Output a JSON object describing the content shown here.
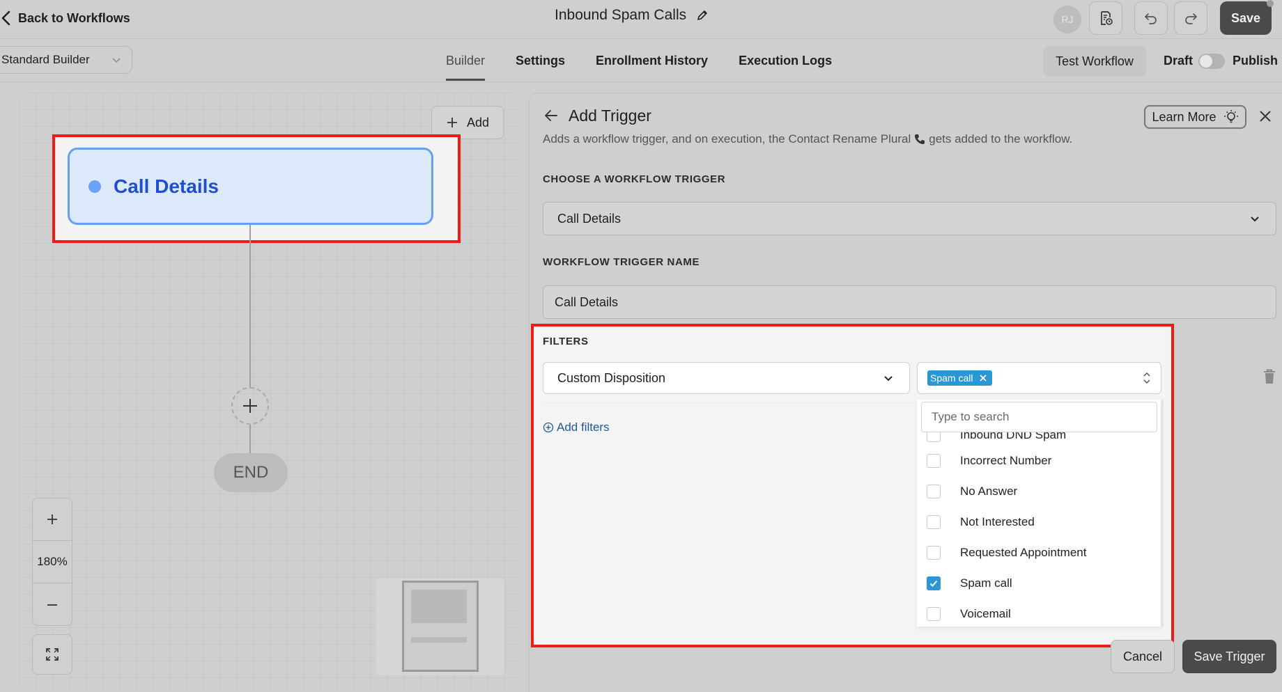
{
  "topbar": {
    "back_label": "Back to Workflows",
    "workflow_title": "Inbound Spam Calls",
    "avatar_initials": "RJ",
    "save_label": "Save"
  },
  "subbar": {
    "builder_mode": "Standard Builder",
    "tabs": [
      {
        "label": "Builder",
        "active": true
      },
      {
        "label": "Settings",
        "active": false
      },
      {
        "label": "Enrollment History",
        "active": false
      },
      {
        "label": "Execution Logs",
        "active": false
      }
    ],
    "test_workflow_label": "Test Workflow",
    "draft_label": "Draft",
    "publish_label": "Publish",
    "publish_toggle_on": false
  },
  "canvas": {
    "add_label": "Add",
    "trigger_node_label": "Call Details",
    "end_label": "END",
    "zoom_level": "180%"
  },
  "panel": {
    "title": "Add Trigger",
    "learn_more_label": "Learn More",
    "description_prefix": "Adds a workflow trigger, and on execution, the Contact Rename Plural",
    "description_suffix": "gets added to the workflow.",
    "choose_trigger_label": "CHOOSE A WORKFLOW TRIGGER",
    "trigger_value": "Call Details",
    "trigger_name_label": "WORKFLOW TRIGGER NAME",
    "trigger_name_value": "Call Details",
    "filters_label": "FILTERS",
    "filter_field": "Custom Disposition",
    "selected_chip": "Spam call",
    "add_filters_label": "Add filters",
    "search_placeholder": "Type to search",
    "options": [
      {
        "label": "Inbound DND Spam",
        "checked": false
      },
      {
        "label": "Incorrect Number",
        "checked": false
      },
      {
        "label": "No Answer",
        "checked": false
      },
      {
        "label": "Not Interested",
        "checked": false
      },
      {
        "label": "Requested Appointment",
        "checked": false
      },
      {
        "label": "Spam call",
        "checked": true
      },
      {
        "label": "Voicemail",
        "checked": false
      }
    ],
    "cancel_label": "Cancel",
    "save_trigger_label": "Save Trigger"
  },
  "colors": {
    "highlight_red": "#ef1b14",
    "node_blue": "#1f4fd0",
    "chip_blue": "#2a96d3"
  }
}
